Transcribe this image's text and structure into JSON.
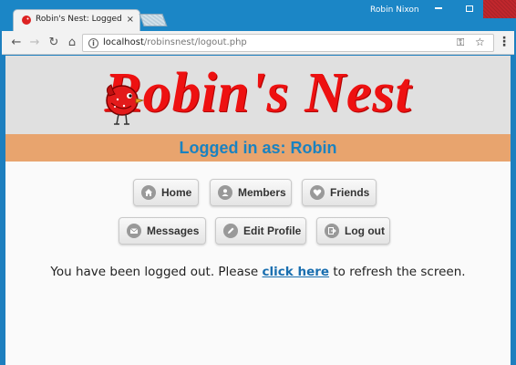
{
  "window": {
    "tab_title": "Robin's Nest: Logged in as",
    "user_name": "Robin Nixon"
  },
  "toolbar": {
    "url_host": "localhost",
    "url_path": "/robinsnest/logout.php"
  },
  "header": {
    "logo_text": "Robin's Nest",
    "logged_in_text": "Logged in as: Robin"
  },
  "colors": {
    "logo_red": "#ee1111",
    "bar_orange": "#e8a46e",
    "logged_blue": "#1a82c0",
    "link_blue": "#1a6fb0"
  },
  "menu": {
    "home": "Home",
    "members": "Members",
    "friends": "Friends",
    "messages": "Messages",
    "edit_profile": "Edit Profile",
    "log_out": "Log out"
  },
  "icons": {
    "home": "home-icon",
    "members": "user-icon",
    "friends": "heart-icon",
    "messages": "mail-icon",
    "edit_profile": "pencil-icon",
    "log_out": "logout-icon"
  },
  "message": {
    "before": "You have been logged out. Please ",
    "link": "click here",
    "after": " to refresh the screen."
  }
}
